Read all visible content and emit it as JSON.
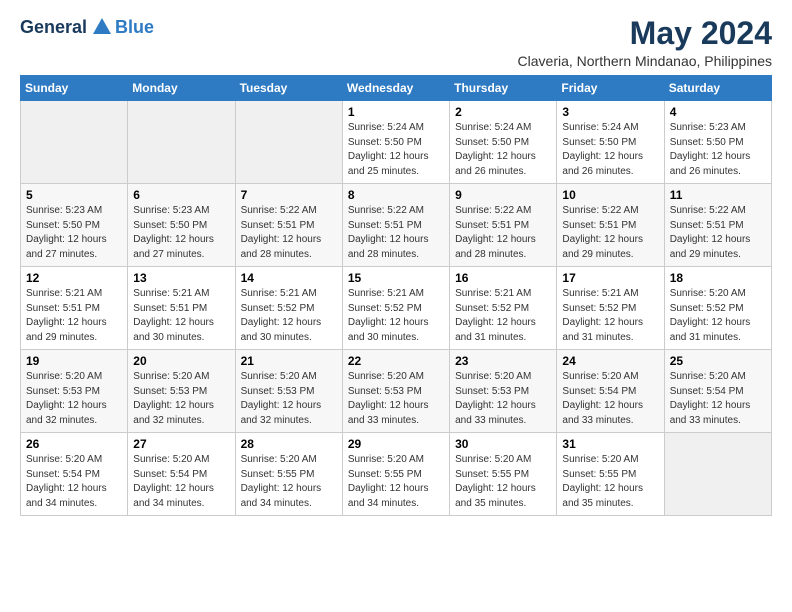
{
  "header": {
    "logo_general": "General",
    "logo_blue": "Blue",
    "month_year": "May 2024",
    "location": "Claveria, Northern Mindanao, Philippines"
  },
  "weekdays": [
    "Sunday",
    "Monday",
    "Tuesday",
    "Wednesday",
    "Thursday",
    "Friday",
    "Saturday"
  ],
  "weeks": [
    [
      {
        "day": "",
        "sunrise": "",
        "sunset": "",
        "daylight": ""
      },
      {
        "day": "",
        "sunrise": "",
        "sunset": "",
        "daylight": ""
      },
      {
        "day": "",
        "sunrise": "",
        "sunset": "",
        "daylight": ""
      },
      {
        "day": "1",
        "sunrise": "5:24 AM",
        "sunset": "5:50 PM",
        "daylight": "12 hours and 25 minutes."
      },
      {
        "day": "2",
        "sunrise": "5:24 AM",
        "sunset": "5:50 PM",
        "daylight": "12 hours and 26 minutes."
      },
      {
        "day": "3",
        "sunrise": "5:24 AM",
        "sunset": "5:50 PM",
        "daylight": "12 hours and 26 minutes."
      },
      {
        "day": "4",
        "sunrise": "5:23 AM",
        "sunset": "5:50 PM",
        "daylight": "12 hours and 26 minutes."
      }
    ],
    [
      {
        "day": "5",
        "sunrise": "5:23 AM",
        "sunset": "5:50 PM",
        "daylight": "12 hours and 27 minutes."
      },
      {
        "day": "6",
        "sunrise": "5:23 AM",
        "sunset": "5:50 PM",
        "daylight": "12 hours and 27 minutes."
      },
      {
        "day": "7",
        "sunrise": "5:22 AM",
        "sunset": "5:51 PM",
        "daylight": "12 hours and 28 minutes."
      },
      {
        "day": "8",
        "sunrise": "5:22 AM",
        "sunset": "5:51 PM",
        "daylight": "12 hours and 28 minutes."
      },
      {
        "day": "9",
        "sunrise": "5:22 AM",
        "sunset": "5:51 PM",
        "daylight": "12 hours and 28 minutes."
      },
      {
        "day": "10",
        "sunrise": "5:22 AM",
        "sunset": "5:51 PM",
        "daylight": "12 hours and 29 minutes."
      },
      {
        "day": "11",
        "sunrise": "5:22 AM",
        "sunset": "5:51 PM",
        "daylight": "12 hours and 29 minutes."
      }
    ],
    [
      {
        "day": "12",
        "sunrise": "5:21 AM",
        "sunset": "5:51 PM",
        "daylight": "12 hours and 29 minutes."
      },
      {
        "day": "13",
        "sunrise": "5:21 AM",
        "sunset": "5:51 PM",
        "daylight": "12 hours and 30 minutes."
      },
      {
        "day": "14",
        "sunrise": "5:21 AM",
        "sunset": "5:52 PM",
        "daylight": "12 hours and 30 minutes."
      },
      {
        "day": "15",
        "sunrise": "5:21 AM",
        "sunset": "5:52 PM",
        "daylight": "12 hours and 30 minutes."
      },
      {
        "day": "16",
        "sunrise": "5:21 AM",
        "sunset": "5:52 PM",
        "daylight": "12 hours and 31 minutes."
      },
      {
        "day": "17",
        "sunrise": "5:21 AM",
        "sunset": "5:52 PM",
        "daylight": "12 hours and 31 minutes."
      },
      {
        "day": "18",
        "sunrise": "5:20 AM",
        "sunset": "5:52 PM",
        "daylight": "12 hours and 31 minutes."
      }
    ],
    [
      {
        "day": "19",
        "sunrise": "5:20 AM",
        "sunset": "5:53 PM",
        "daylight": "12 hours and 32 minutes."
      },
      {
        "day": "20",
        "sunrise": "5:20 AM",
        "sunset": "5:53 PM",
        "daylight": "12 hours and 32 minutes."
      },
      {
        "day": "21",
        "sunrise": "5:20 AM",
        "sunset": "5:53 PM",
        "daylight": "12 hours and 32 minutes."
      },
      {
        "day": "22",
        "sunrise": "5:20 AM",
        "sunset": "5:53 PM",
        "daylight": "12 hours and 33 minutes."
      },
      {
        "day": "23",
        "sunrise": "5:20 AM",
        "sunset": "5:53 PM",
        "daylight": "12 hours and 33 minutes."
      },
      {
        "day": "24",
        "sunrise": "5:20 AM",
        "sunset": "5:54 PM",
        "daylight": "12 hours and 33 minutes."
      },
      {
        "day": "25",
        "sunrise": "5:20 AM",
        "sunset": "5:54 PM",
        "daylight": "12 hours and 33 minutes."
      }
    ],
    [
      {
        "day": "26",
        "sunrise": "5:20 AM",
        "sunset": "5:54 PM",
        "daylight": "12 hours and 34 minutes."
      },
      {
        "day": "27",
        "sunrise": "5:20 AM",
        "sunset": "5:54 PM",
        "daylight": "12 hours and 34 minutes."
      },
      {
        "day": "28",
        "sunrise": "5:20 AM",
        "sunset": "5:55 PM",
        "daylight": "12 hours and 34 minutes."
      },
      {
        "day": "29",
        "sunrise": "5:20 AM",
        "sunset": "5:55 PM",
        "daylight": "12 hours and 34 minutes."
      },
      {
        "day": "30",
        "sunrise": "5:20 AM",
        "sunset": "5:55 PM",
        "daylight": "12 hours and 35 minutes."
      },
      {
        "day": "31",
        "sunrise": "5:20 AM",
        "sunset": "5:55 PM",
        "daylight": "12 hours and 35 minutes."
      },
      {
        "day": "",
        "sunrise": "",
        "sunset": "",
        "daylight": ""
      }
    ]
  ]
}
